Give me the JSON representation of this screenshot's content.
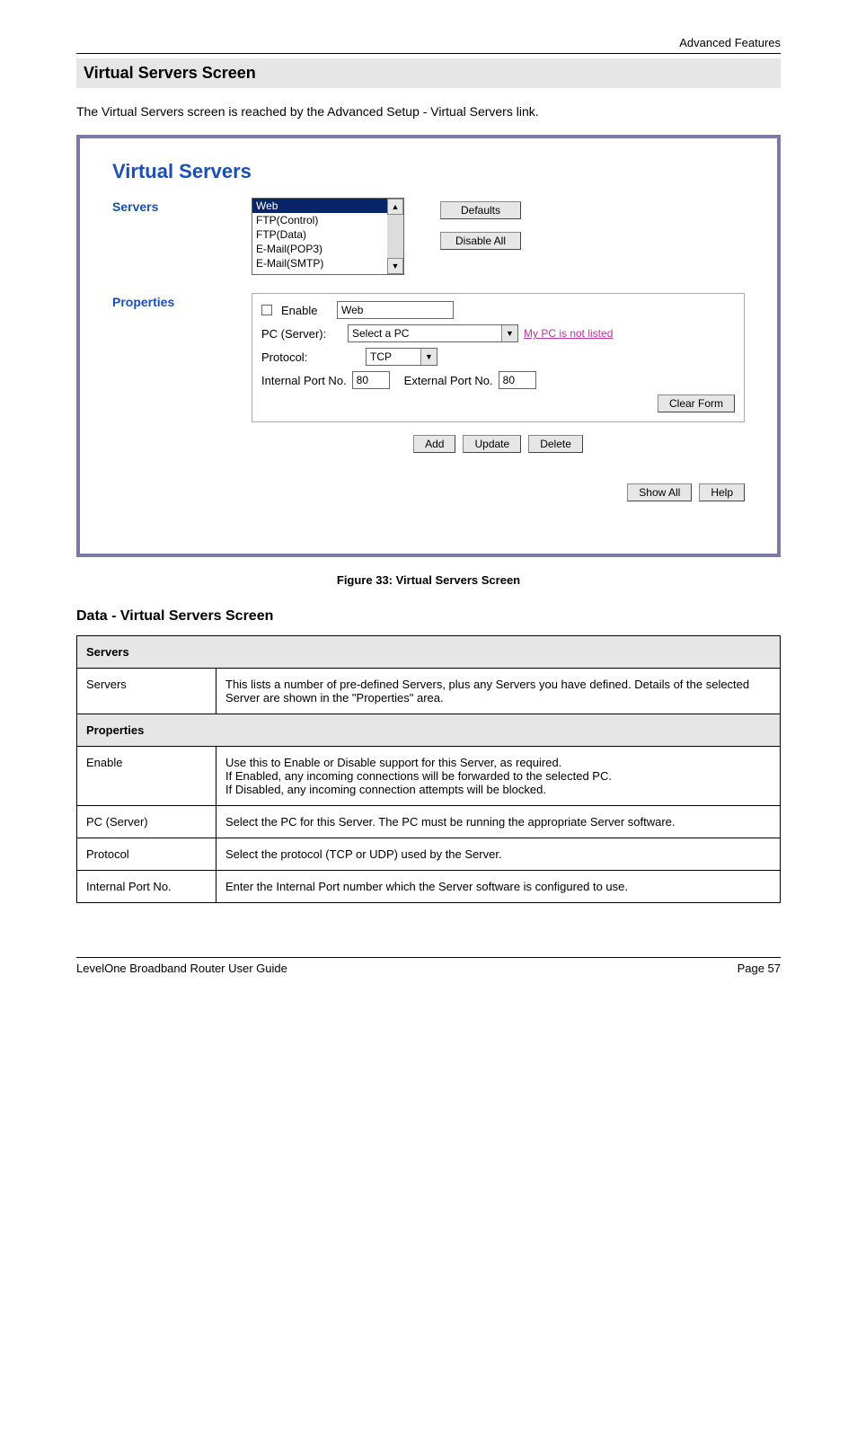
{
  "header_right": "Advanced Features",
  "section_title": "Virtual Servers Screen",
  "intro": "The Virtual Servers screen is reached by the Advanced Setup - Virtual Servers link.",
  "panel": {
    "title": "Virtual Servers",
    "servers_label": "Servers",
    "server_items": [
      "Web",
      "FTP(Control)",
      "FTP(Data)",
      "E-Mail(POP3)",
      "E-Mail(SMTP)"
    ],
    "defaults_btn": "Defaults",
    "disable_all_btn": "Disable All",
    "properties_label": "Properties",
    "enable_label": "Enable",
    "name_value": "Web",
    "pc_server_label": "PC (Server):",
    "pc_server_value": "Select a PC",
    "mypc_link": "My PC is not listed",
    "protocol_label": "Protocol:",
    "protocol_value": "TCP",
    "internal_port_label": "Internal Port No.",
    "internal_port_value": "80",
    "external_port_label": "External Port No.",
    "external_port_value": "80",
    "clear_form_btn": "Clear Form",
    "add_btn": "Add",
    "update_btn": "Update",
    "delete_btn": "Delete",
    "show_all_btn": "Show All",
    "help_btn": "Help"
  },
  "figure_caption": "Figure 33: Virtual Servers Screen",
  "subheading": "Data - Virtual Servers Screen",
  "table": {
    "band1": "Servers",
    "row1_key": "Servers",
    "row1_val": "This lists a number of pre-defined Servers, plus any Servers you have defined. Details of the selected Server are shown in the \"Properties\" area.",
    "band2": "Properties",
    "row2_key": "Enable",
    "row2_val": "Use this to Enable or Disable support for this Server, as required.\nIf Enabled, any incoming connections will be forwarded to the selected PC.\nIf Disabled, any incoming connection attempts will be blocked.",
    "row3_key": "PC (Server)",
    "row3_val": "Select the PC for this Server. The PC must be running the appropriate Server software.",
    "row4_key": "Protocol",
    "row4_val": "Select the protocol (TCP or UDP) used by the Server.",
    "row5_key": "Internal Port No.",
    "row5_val": "Enter the Internal Port number which the Server software is configured to use."
  },
  "footer_left": "LevelOne Broadband Router User Guide",
  "footer_right": "Page 57"
}
